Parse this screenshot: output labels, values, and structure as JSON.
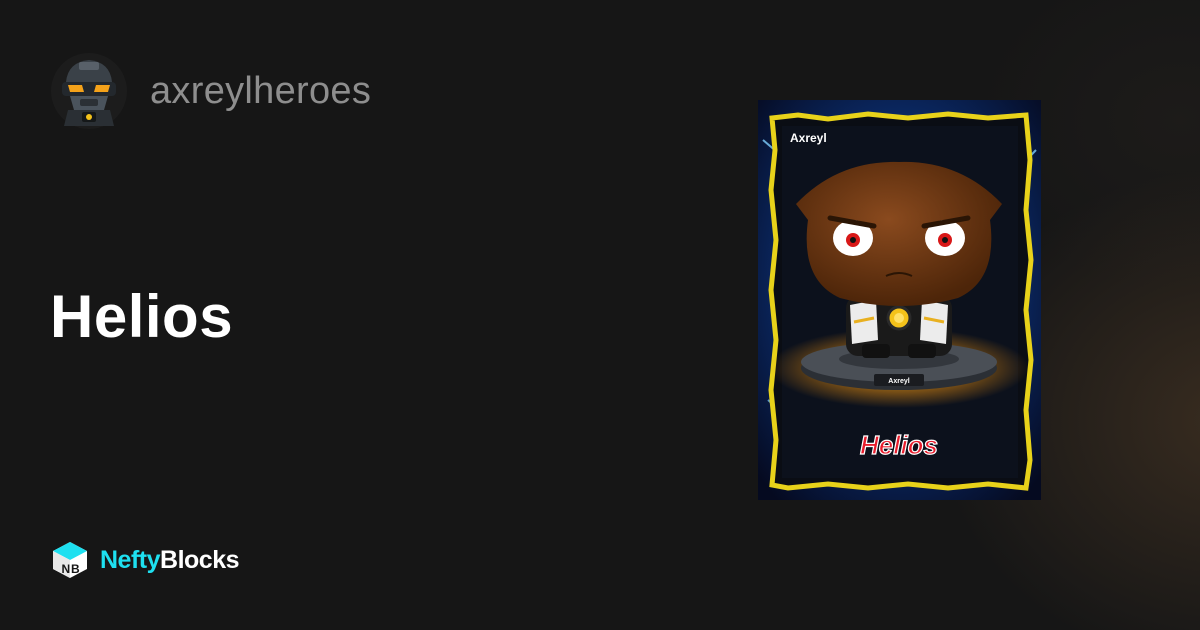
{
  "collection": {
    "name": "axreylheroes",
    "avatar_icon": "robot-helmet-icon"
  },
  "asset": {
    "name": "Helios",
    "card": {
      "top_label": "Axreyl",
      "base_label": "Axreyl",
      "name_text": "Helios"
    }
  },
  "brand": {
    "part1": "Nefty",
    "part2": "Blocks",
    "icon": "nb-cube-icon",
    "accent_color": "#1ee0f0"
  },
  "colors": {
    "background": "#161616",
    "title": "#ffffff",
    "muted": "#8e8e8e"
  }
}
